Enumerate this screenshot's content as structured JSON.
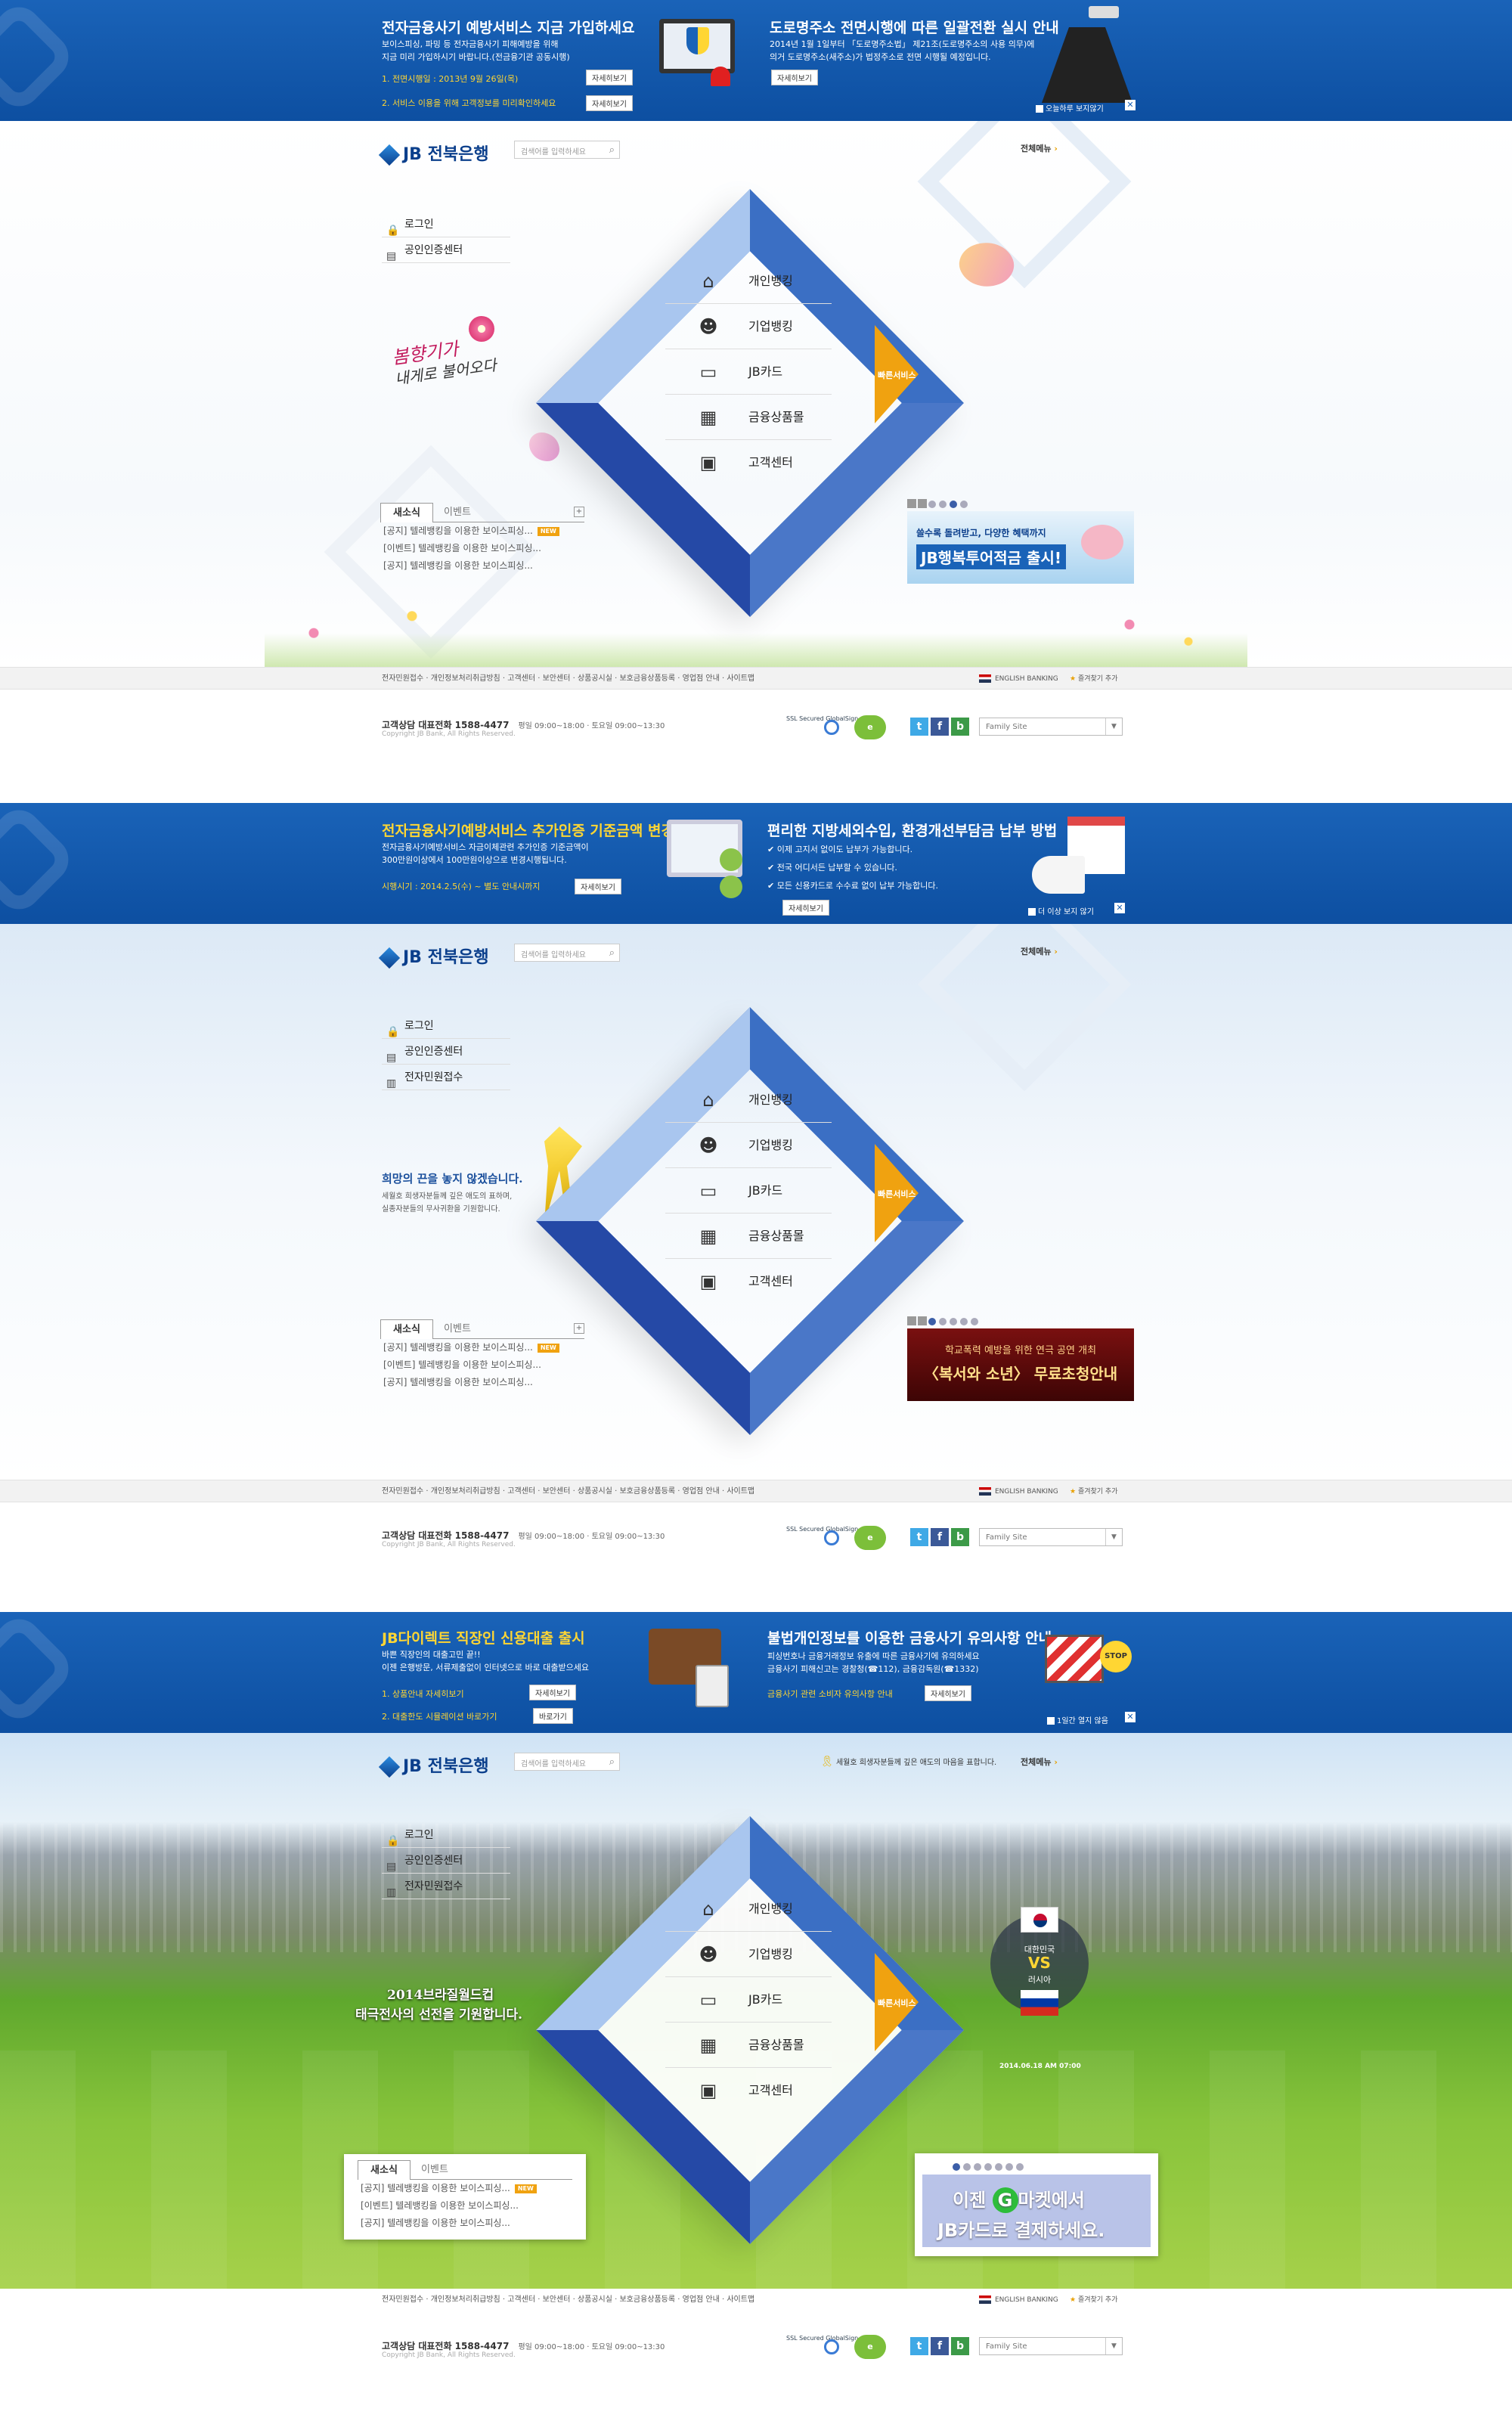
{
  "colors": {
    "brand": "#0b3f8c",
    "banner": "#1760b4",
    "accent": "#f0a210",
    "yellow": "#ffd633"
  },
  "common": {
    "logo": "JB 전북은행",
    "search_placeholder": "검색어를 입력하세요",
    "all_menu": "전체메뉴",
    "login": "로그인",
    "cert_center": "공인인증센터",
    "civil": "전자민원접수",
    "menu": [
      {
        "label": "개인뱅킹",
        "icon": "home-icon",
        "glyph": "⌂"
      },
      {
        "label": "기업뱅킹",
        "icon": "person-icon",
        "glyph": "👤"
      },
      {
        "label": "JB카드",
        "icon": "card-icon",
        "glyph": "▭"
      },
      {
        "label": "금융상품몰",
        "icon": "gift-icon",
        "glyph": "▦"
      },
      {
        "label": "고객센터",
        "icon": "monitor-icon",
        "glyph": "🖵"
      }
    ],
    "quick": "빠른서비스",
    "tab_news": "새소식",
    "tab_event": "이벤트",
    "news": [
      "[공지] 텔레뱅킹을 이용한 보이스피싱...",
      "[이벤트] 텔레뱅킹을 이용한 보이스피싱...",
      "[공지] 텔레뱅킹을 이용한 보이스피싱..."
    ],
    "new_badge": "NEW",
    "footer_links": "전자민원접수 · 개인정보처리취급방침 · 고객센터 · 보안센터 · 상품공시실 · 보호금융상품등록 · 영업점 안내 · 사이트맵",
    "english": "ENGLISH BANKING",
    "favorite": "즐겨찾기 추가",
    "cs_title": "고객상담 대표전화 1588-4477",
    "cs_hours": "평일 09:00~18:00 · 토요일 09:00~13:30",
    "copyright": "Copyright JB Bank, All Rights Reserved.",
    "ssl": "SSL Secured GlobalSign",
    "family": "Family Site"
  },
  "s1": {
    "b1_title": "전자금융사기 예방서비스 지금 가입하세요",
    "b1_desc": [
      "보이스피싱, 파밍 등 전자금융사기 피해예방을 위해",
      "지금 미리 가입하시기 바랍니다.(전금융기관 공동시행)"
    ],
    "b1_line1": "1. 전면시행일 : 2013년 9월 26일(목)",
    "b1_line2": "2. 서비스 이용을 위해 고객정보를 미리확인하세요",
    "b1_btn": "자세히보기",
    "b2_title": "도로명주소 전면시행에 따른 일괄전환 실시 안내",
    "b2_desc": [
      "2014년 1월 1일부터 「도로명주소법」 제21조(도로명주소의 사용 의무)에",
      "의거 도로명주소(새주소)가 법정주소로 전면 시행될 예정입니다."
    ],
    "b2_btn": "자세히보기",
    "close_text": "오늘하루 보지않기",
    "side_text": [
      "봄향기가",
      "내게로 불어오다"
    ],
    "promo": [
      "쓸수록 돌려받고, 다양한 혜택까지",
      "JB행복투어적금 출시!"
    ]
  },
  "s2": {
    "b1_title": "전자금융사기예방서비스 추가인증 기준금액 변경",
    "b1_desc": [
      "전자금융사기예방서비스 자금이체관련 추가인증 기준금액이",
      "300만원이상에서 100만원이상으로 변경시행됩니다."
    ],
    "b1_line": "시행시기 : 2014.2.5(수) ~ 별도 안내시까지",
    "b1_btn": "자세히보기",
    "b2_title": "편리한 지방세외수입, 환경개선부담금 납부 방법",
    "b2_items": [
      "이제 고지서 없이도 납부가 가능합니다.",
      "전국 어디서든 납부할 수 있습니다.",
      "모든 신용카드로 수수료 없이 납부 가능합니다."
    ],
    "b2_btn": "자세히보기",
    "close_text": "더 이상 보지 않기",
    "side_title": "희망의 끈을 놓지 않겠습니다.",
    "side_desc": [
      "세월호 희생자분들께 깊은 애도의 표하며,",
      "실종자분들의 무사귀환을 기원합니다."
    ],
    "promo": [
      "학교폭력 예방을 위한 연극 공연 개최",
      "〈복서와 소년〉 무료초청안내"
    ]
  },
  "s3": {
    "b1_title": "JB다이렉트 직장인 신용대출 출시",
    "b1_desc": [
      "바쁜 직장인의 대출고민 끝!!",
      "이젠 은행방문, 서류제출없이 인터넷으로 바로 대출받으세요"
    ],
    "b1_line1": "1. 상품안내 자세히보기",
    "b1_line2": "2. 대출한도 시뮬레이션 바로가기",
    "b1_btn1": "자세히보기",
    "b1_btn2": "바로가기",
    "b2_title": "불법개인정보를 이용한 금융사기 유의사항 안내",
    "b2_desc": [
      "피싱번호나 금융거래정보 유출에 따른 금융사기에 유의하세요",
      "금융사기 피해신고는 경찰청(☎112), 금융감독원(☎1332)"
    ],
    "b2_line": "금융사기 관련 소비자 유의사항 안내",
    "b2_btn": "자세히보기",
    "stop": "STOP",
    "close_text": "1일간 열지 않음",
    "notice": "세월호 희생자분들께 깊은 애도의 마음을 표합니다.",
    "side_title": "2014브라질월드컵",
    "side_sub": "태극전사의 선전을 기원합니다.",
    "match_team1": "대한민국",
    "match_vs": "VS",
    "match_team2": "러시아",
    "match_date": "2014.06.18 AM 07:00",
    "promo1": "이젠",
    "promo_g": "G",
    "promo2": "마켓에서",
    "promo3": "JB카드로 결제하세요."
  }
}
